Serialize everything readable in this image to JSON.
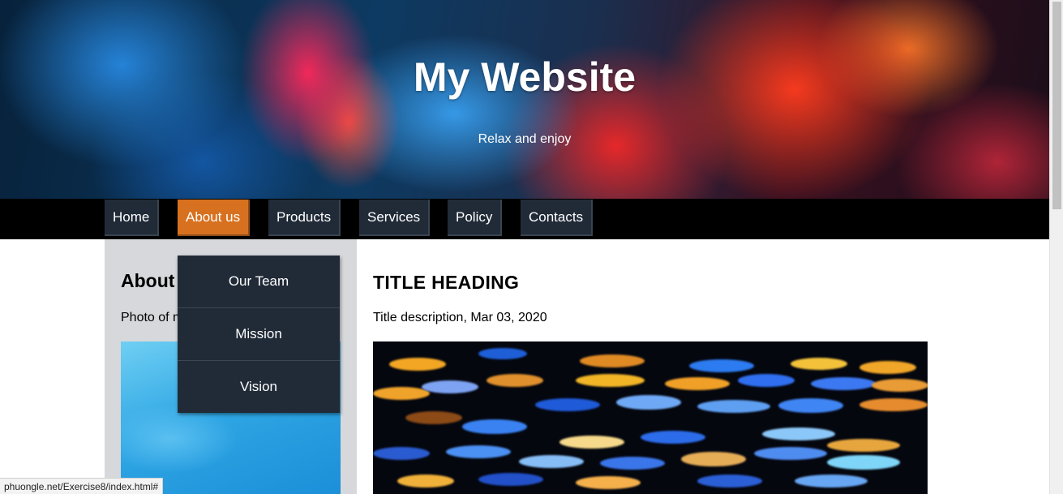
{
  "header": {
    "title": "My Website",
    "subtitle": "Relax and enjoy"
  },
  "nav": {
    "items": [
      {
        "label": "Home",
        "active": false
      },
      {
        "label": "About us",
        "active": true
      },
      {
        "label": "Products",
        "active": false
      },
      {
        "label": "Services",
        "active": false
      },
      {
        "label": "Policy",
        "active": false
      },
      {
        "label": "Contacts",
        "active": false
      }
    ],
    "active_color": "#d8711f",
    "item_color": "#212b38"
  },
  "dropdown": {
    "items": [
      "Our Team",
      "Mission",
      "Vision"
    ]
  },
  "sidebar": {
    "heading": "About",
    "text": "Photo of m"
  },
  "main": {
    "heading": "TITLE HEADING",
    "description": "Title description, Mar 03, 2020"
  },
  "status_bar": {
    "url": "phuongle.net/Exercise8/index.html#"
  }
}
